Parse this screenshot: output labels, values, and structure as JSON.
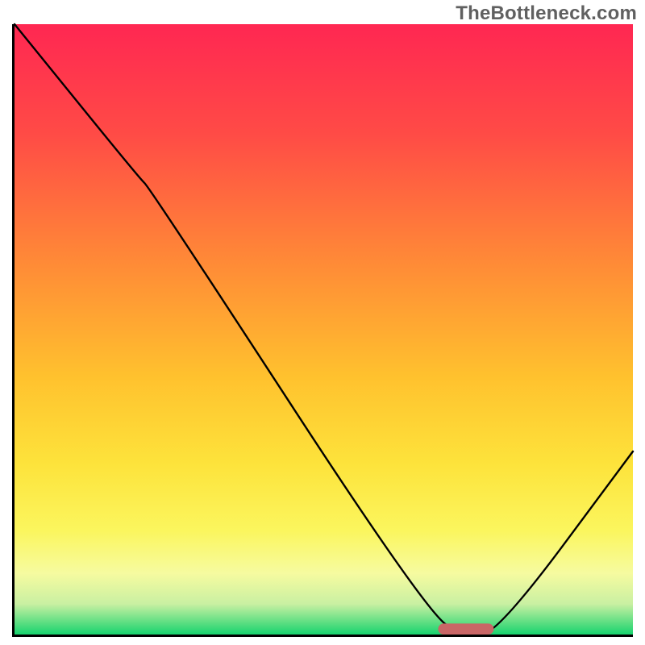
{
  "watermark": "TheBottleneck.com",
  "chart_data": {
    "type": "line",
    "title": "",
    "xlabel": "",
    "ylabel": "",
    "x_range_pct": [
      0,
      100
    ],
    "y_range_pct": [
      0,
      100
    ],
    "series": [
      {
        "name": "bottleneck-curve",
        "x_pct": [
          0,
          20,
          22,
          67,
          73,
          78,
          100
        ],
        "y_pct": [
          100,
          75,
          73,
          3,
          0,
          0,
          30
        ],
        "comment": "Piecewise curve: steep descent from top-left, slight bend ~20%, continues down to a flat minimum around x≈73–78%, then rises toward the right edge (~30% high)."
      }
    ],
    "marker": {
      "name": "sweet-spot",
      "shape": "rounded-bar",
      "x_pct_center": 73,
      "width_pct": 9,
      "y_pct": 0,
      "color": "#c96666"
    },
    "background_gradient_stops": [
      {
        "pct": 0,
        "color": "#ff2752"
      },
      {
        "pct": 18,
        "color": "#ff4b46"
      },
      {
        "pct": 40,
        "color": "#ff8d36"
      },
      {
        "pct": 58,
        "color": "#ffc22e"
      },
      {
        "pct": 72,
        "color": "#fde33b"
      },
      {
        "pct": 83,
        "color": "#fbf65e"
      },
      {
        "pct": 90,
        "color": "#f6fba0"
      },
      {
        "pct": 95,
        "color": "#c9f0a2"
      },
      {
        "pct": 100,
        "color": "#17d36e"
      }
    ]
  }
}
